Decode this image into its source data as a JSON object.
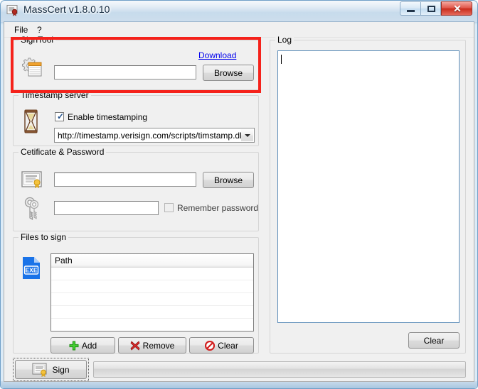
{
  "window": {
    "title": "MassCert v1.8.0.10",
    "app_icon": "certificate-document-icon",
    "controls": {
      "minimize": "minimize-icon",
      "maximize": "maximize-icon",
      "close_label": "✕"
    }
  },
  "menubar": {
    "items": [
      {
        "label": "File",
        "name": "menu-file"
      },
      {
        "label": "?",
        "name": "menu-help"
      }
    ]
  },
  "signtool": {
    "group_title": "SignTool",
    "icon": "gear-window-icon",
    "path_value": "",
    "path_placeholder": "",
    "download_link": "Download",
    "browse_label": "Browse",
    "highlight_color": "#f5221b"
  },
  "timestamp": {
    "group_title": "Timestamp server",
    "icon": "hourglass-icon",
    "enable_label": "Enable timestamping",
    "enable_checked": true,
    "server_value": "http://timestamp.verisign.com/scripts/timstamp.dll",
    "server_options": [
      "http://timestamp.verisign.com/scripts/timstamp.dll"
    ]
  },
  "certificate": {
    "group_title": "Cetificate & Password",
    "cert_icon": "certificate-icon",
    "key_icon": "key-icon",
    "cert_value": "",
    "browse_label": "Browse",
    "password_value": "",
    "remember_label": "Remember password",
    "remember_checked": false,
    "remember_enabled": false
  },
  "files": {
    "group_title": "Files to sign",
    "icon": "exe-file-icon",
    "columns": [
      "Path"
    ],
    "rows": [],
    "empty_row_count": 6,
    "buttons": {
      "add_label": "Add",
      "add_icon": "plus-icon",
      "remove_label": "Remove",
      "remove_icon": "x-icon",
      "clear_label": "Clear",
      "clear_icon": "no-entry-icon"
    }
  },
  "log": {
    "group_title": "Log",
    "content": "",
    "clear_label": "Clear"
  },
  "bottom": {
    "sign_label": "Sign",
    "sign_icon": "sign-document-icon",
    "progress_value": 0,
    "progress_text": ""
  },
  "colors": {
    "accent_red": "#f5221b",
    "link_blue": "#0000ee",
    "exe_blue": "#1a73e8",
    "focus_border": "#5b8cb8"
  }
}
